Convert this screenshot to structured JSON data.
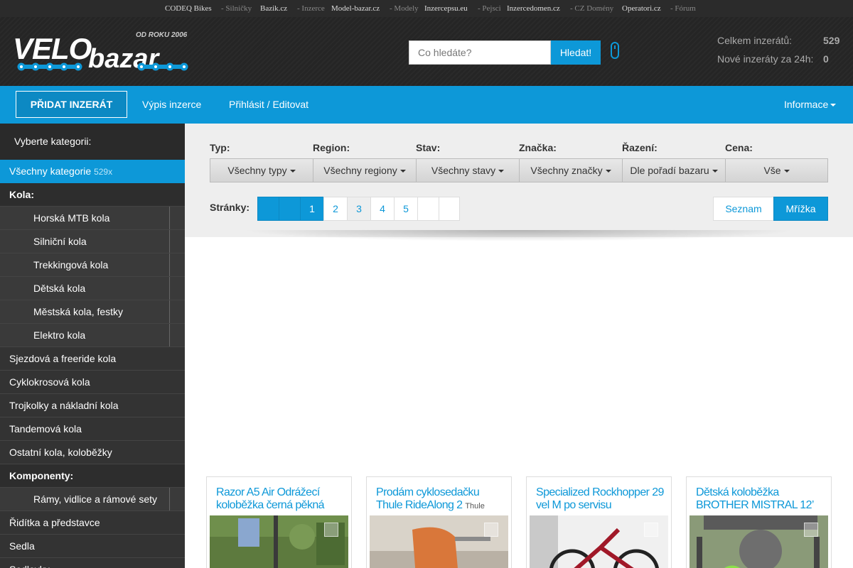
{
  "top_links": [
    {
      "type": "site",
      "text": "CODEQ Bikes"
    },
    {
      "type": "sep",
      "text": "- Silničky"
    },
    {
      "type": "site",
      "text": "Bazik.cz"
    },
    {
      "type": "sep",
      "text": "- Inzerce"
    },
    {
      "type": "site",
      "text": "Model-bazar.cz"
    },
    {
      "type": "sep",
      "text": "- Modely"
    },
    {
      "type": "site",
      "text": "Inzercepsu.eu"
    },
    {
      "type": "sep",
      "text": "- Pejsci"
    },
    {
      "type": "site",
      "text": "Inzercedomen.cz"
    },
    {
      "type": "sep",
      "text": "- CZ Domény"
    },
    {
      "type": "site",
      "text": "Operatori.cz"
    },
    {
      "type": "sep",
      "text": "- Fórum"
    }
  ],
  "logo": {
    "since": "OD ROKU 2006",
    "velo": "VELO",
    "bazar": "bazar"
  },
  "search": {
    "placeholder": "Co hledáte?",
    "button": "Hledat!"
  },
  "stats": {
    "total_label": "Celkem inzerátů:",
    "total_value": "529",
    "new_label": "Nové inzeráty za 24h:",
    "new_value": "0"
  },
  "nav": {
    "add_label": " PŘIDAT INZERÁT",
    "list_label": " Výpis inzerce",
    "login_label": " Přihlásit / Editovat",
    "info_label": " Informace"
  },
  "sidebar": {
    "heading": "Vyberte kategorii:",
    "all_label": "Všechny kategorie",
    "all_count": "529x",
    "group_bikes": "Kola:",
    "bike_subs": [
      "Horská MTB kola",
      "Silniční kola",
      "Trekkingová kola",
      "Dětská kola",
      "Městská kola, festky",
      "Elektro kola"
    ],
    "bike_plain": [
      "Sjezdová a freeride kola",
      "Cyklokrosová kola",
      "Trojkolky a nákladní kola",
      "Tandemová kola",
      "Ostatní kola, koloběžky"
    ],
    "group_components": "Komponenty:",
    "comp_subs": [
      "Rámy, vidlice a rámové sety"
    ],
    "comp_plain": [
      "Řidítka a představce",
      "Sedla",
      "Sedlovky"
    ]
  },
  "filters": {
    "type_label": "Typ:",
    "type_value": "Všechny typy",
    "region_label": "Region:",
    "region_value": "Všechny regiony",
    "state_label": "Stav:",
    "state_value": "Všechny stavy",
    "brand_label": "Značka:",
    "brand_value": "Všechny značky",
    "sort_label": "Řazení:",
    "sort_value": "Dle pořadí bazaru",
    "price_label": "Cena:",
    "price_value": "Vše"
  },
  "pagination": {
    "label": "Stránky:",
    "pages": [
      "1",
      "2",
      "3",
      "4",
      "5"
    ],
    "current": "1",
    "list_view": " Seznam",
    "grid_view": " Mřížka"
  },
  "cards": [
    {
      "title": "Razor A5 Air Odrážecí koloběžka černá pěkná",
      "brand": ""
    },
    {
      "title": "Prodám cyklosedačku Thule RideAlong 2",
      "brand": "Thule"
    },
    {
      "title": "Specialized Rockhopper 29 vel M po servisu",
      "brand": ""
    },
    {
      "title": "Dětská koloběžka BROTHER MISTRAL 12’",
      "brand": ""
    }
  ],
  "colors": {
    "accent": "#0d98d8",
    "header_bg": "#252525",
    "sidebar_bg": "#333333"
  },
  "icons": {
    "user": "user-icon",
    "add": "plus-icon",
    "list": "list-icon",
    "login": "login-icon",
    "info": "info-icon",
    "star": "star-icon",
    "chevron": "chevron-right-icon"
  }
}
